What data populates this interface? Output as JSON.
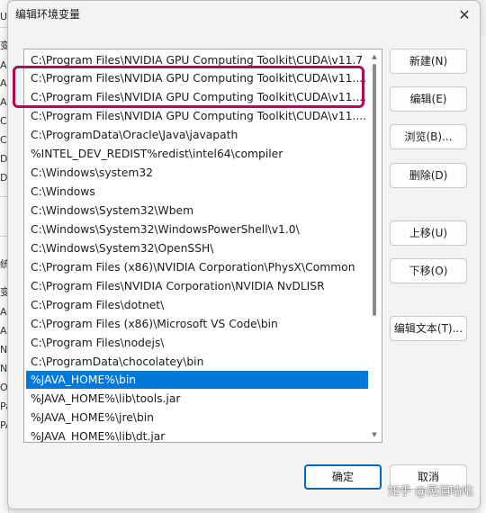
{
  "dialog": {
    "title": "编辑环境变量",
    "close_glyph": "✕"
  },
  "background_fragments": [
    "U",
    "变",
    "A",
    "A",
    "A",
    "Ch",
    "CL",
    "DA",
    "DA",
    "统",
    "变",
    "A",
    "A",
    "N",
    "N",
    "OS",
    "Pa",
    "PA"
  ],
  "path_list": {
    "items": [
      "C:\\Program Files\\NVIDIA GPU Computing Toolkit\\CUDA\\v11.7",
      "C:\\Program Files\\NVIDIA GPU Computing Toolkit\\CUDA\\v11....",
      "C:\\Program Files\\NVIDIA GPU Computing Toolkit\\CUDA\\v11....",
      "C:\\Program Files\\NVIDIA GPU Computing Toolkit\\CUDA\\v11....",
      "C:\\ProgramData\\Oracle\\Java\\javapath",
      "%INTEL_DEV_REDIST%redist\\intel64\\compiler",
      "C:\\Windows\\system32",
      "C:\\Windows",
      "C:\\Windows\\System32\\Wbem",
      "C:\\Windows\\System32\\WindowsPowerShell\\v1.0\\",
      "C:\\Windows\\System32\\OpenSSH\\",
      "C:\\Program Files (x86)\\NVIDIA Corporation\\PhysX\\Common",
      "C:\\Program Files\\NVIDIA Corporation\\NVIDIA NvDLISR",
      "C:\\Program Files\\dotnet\\",
      "C:\\Program Files (x86)\\Microsoft VS Code\\bin",
      "C:\\Program Files\\nodejs\\",
      "C:\\ProgramData\\chocolatey\\bin",
      "%JAVA_HOME%\\bin",
      "%JAVA_HOME%\\lib\\tools.jar",
      "%JAVA_HOME%\\jre\\bin",
      "%JAVA_HOME%\\lib\\dt.jar"
    ],
    "selected_index": 17,
    "highlighted_indices": [
      1,
      2
    ]
  },
  "buttons": {
    "new": "新建(N)",
    "edit": "编辑(E)",
    "browse": "浏览(B)...",
    "delete": "删除(D)",
    "move_up": "上移(U)",
    "move_down": "下移(O)",
    "edit_text": "编辑文本(T)...",
    "ok": "确定",
    "cancel": "取消"
  },
  "watermark": "知乎 @晃酒咕咕",
  "colors": {
    "selection": "#0078d7",
    "highlight_box": "#b00a59",
    "default_button_border": "#0067c0"
  }
}
